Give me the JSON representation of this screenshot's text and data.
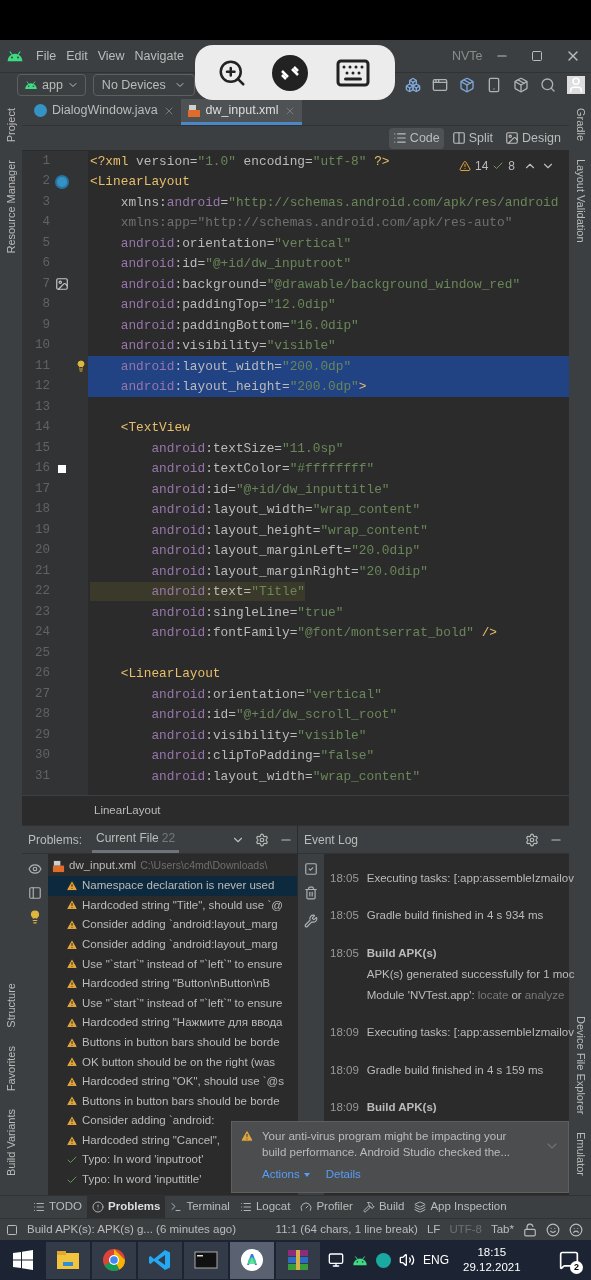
{
  "menu": [
    "File",
    "Edit",
    "View",
    "Navigate"
  ],
  "window": {
    "title": "NVTe"
  },
  "toolbar": {
    "module": "app",
    "device": "No Devices"
  },
  "editor_tabs": [
    {
      "label": "DialogWindow.java",
      "kind": "java",
      "selected": false
    },
    {
      "label": "dw_input.xml",
      "kind": "xml",
      "selected": true
    }
  ],
  "view_modes": [
    {
      "label": "Code",
      "kind": "code",
      "selected": true
    },
    {
      "label": "Split",
      "kind": "split",
      "selected": false
    },
    {
      "label": "Design",
      "kind": "design",
      "selected": false
    }
  ],
  "left_strip": [
    {
      "label": "Project",
      "kind": "top"
    },
    {
      "label": "Resource Manager",
      "kind": "top"
    },
    {
      "label": "Structure",
      "kind": "bottom"
    },
    {
      "label": "Favorites",
      "kind": "bottom"
    },
    {
      "label": "Build Variants",
      "kind": "bottom"
    }
  ],
  "right_strip": [
    {
      "label": "Gradle",
      "kind": "top"
    },
    {
      "label": "Layout Validation",
      "kind": "top"
    },
    {
      "label": "Device File Explorer",
      "kind": "bottom"
    },
    {
      "label": "Emulator",
      "kind": "bottom"
    }
  ],
  "inspections": {
    "warnings": "14",
    "typos": "8"
  },
  "code_lines": [
    {
      "number": "1",
      "kind": "plain",
      "selected": false,
      "tokens": [
        {
          "kind": "tag",
          "text": "<?xml "
        },
        {
          "kind": "attr",
          "text": "version="
        },
        {
          "kind": "value",
          "text": "\"1.0\" "
        },
        {
          "kind": "attr",
          "text": "encoding="
        },
        {
          "kind": "value",
          "text": "\"utf-8\" "
        },
        {
          "kind": "tag",
          "text": "?>"
        }
      ]
    },
    {
      "number": "2",
      "kind": "class",
      "selected": false,
      "tokens": [
        {
          "kind": "tag",
          "text": "<LinearLayout"
        }
      ]
    },
    {
      "number": "3",
      "kind": "plain",
      "selected": false,
      "tokens": [
        {
          "kind": "attr",
          "text": "    xmlns:"
        },
        {
          "kind": "ns",
          "text": "android"
        },
        {
          "kind": "attr",
          "text": "="
        },
        {
          "kind": "value",
          "text": "\"http://schemas.android.com/apk/res/android"
        }
      ]
    },
    {
      "number": "4",
      "kind": "plain",
      "selected": false,
      "tokens": [
        {
          "kind": "unused",
          "text": "    xmlns:app=\"http://schemas.android.com/apk/res-auto\""
        }
      ]
    },
    {
      "number": "5",
      "kind": "plain",
      "selected": false,
      "tokens": [
        {
          "kind": "ns",
          "text": "    android"
        },
        {
          "kind": "attr",
          "text": ":orientation="
        },
        {
          "kind": "value",
          "text": "\"vertical\""
        }
      ]
    },
    {
      "number": "6",
      "kind": "plain",
      "selected": false,
      "tokens": [
        {
          "kind": "ns",
          "text": "    android"
        },
        {
          "kind": "attr",
          "text": ":id="
        },
        {
          "kind": "value",
          "text": "\"@+id/dw_inputroot\""
        }
      ]
    },
    {
      "number": "7",
      "kind": "image",
      "selected": false,
      "tokens": [
        {
          "kind": "ns",
          "text": "    android"
        },
        {
          "kind": "attr",
          "text": ":background="
        },
        {
          "kind": "value",
          "text": "\"@drawable/background_window_red\""
        }
      ]
    },
    {
      "number": "8",
      "kind": "plain",
      "selected": false,
      "tokens": [
        {
          "kind": "ns",
          "text": "    android"
        },
        {
          "kind": "attr",
          "text": ":paddingTop="
        },
        {
          "kind": "value",
          "text": "\"12.0dip\""
        }
      ]
    },
    {
      "number": "9",
      "kind": "plain",
      "selected": false,
      "tokens": [
        {
          "kind": "ns",
          "text": "    android"
        },
        {
          "kind": "attr",
          "text": ":paddingBottom="
        },
        {
          "kind": "value",
          "text": "\"16.0dip\""
        }
      ]
    },
    {
      "number": "10",
      "kind": "plain",
      "selected": false,
      "tokens": [
        {
          "kind": "ns",
          "text": "    android"
        },
        {
          "kind": "attr",
          "text": ":visibility="
        },
        {
          "kind": "value",
          "text": "\"visible\""
        }
      ]
    },
    {
      "number": "11",
      "kind": "bulb",
      "selected": true,
      "tokens": [
        {
          "kind": "ns",
          "text": "    android"
        },
        {
          "kind": "attr",
          "text": ":layout_width="
        },
        {
          "kind": "value",
          "text": "\"200.0dp\""
        }
      ]
    },
    {
      "number": "12",
      "kind": "plain",
      "selected": true,
      "tokens": [
        {
          "kind": "ns",
          "text": "    android"
        },
        {
          "kind": "attr",
          "text": ":layout_height="
        },
        {
          "kind": "value",
          "text": "\"200.0dp\""
        },
        {
          "kind": "tag",
          "text": ">"
        }
      ]
    },
    {
      "number": "13",
      "kind": "plain",
      "selected": false
    },
    {
      "number": "14",
      "kind": "plain",
      "selected": false,
      "tokens": [
        {
          "kind": "tag",
          "text": "    <TextView"
        }
      ]
    },
    {
      "number": "15",
      "kind": "plain",
      "selected": false,
      "tokens": [
        {
          "kind": "ns",
          "text": "        android"
        },
        {
          "kind": "attr",
          "text": ":textSize="
        },
        {
          "kind": "value",
          "text": "\"11.0sp\""
        }
      ]
    },
    {
      "number": "16",
      "kind": "color",
      "selected": false,
      "tokens": [
        {
          "kind": "ns",
          "text": "        android"
        },
        {
          "kind": "attr",
          "text": ":textColor="
        },
        {
          "kind": "value",
          "text": "\"#ffffffff\""
        }
      ]
    },
    {
      "number": "17",
      "kind": "plain",
      "selected": false,
      "tokens": [
        {
          "kind": "ns",
          "text": "        android"
        },
        {
          "kind": "attr",
          "text": ":id="
        },
        {
          "kind": "value",
          "text": "\"@+id/dw_inputtitle\""
        }
      ]
    },
    {
      "number": "18",
      "kind": "plain",
      "selected": false,
      "tokens": [
        {
          "kind": "ns",
          "text": "        android"
        },
        {
          "kind": "attr",
          "text": ":layout_width="
        },
        {
          "kind": "value",
          "text": "\"wrap_content\""
        }
      ]
    },
    {
      "number": "19",
      "kind": "plain",
      "selected": false,
      "tokens": [
        {
          "kind": "ns",
          "text": "        android"
        },
        {
          "kind": "attr",
          "text": ":layout_height="
        },
        {
          "kind": "value",
          "text": "\"wrap_content\""
        }
      ]
    },
    {
      "number": "20",
      "kind": "plain",
      "selected": false,
      "tokens": [
        {
          "kind": "ns",
          "text": "        android"
        },
        {
          "kind": "attr",
          "text": ":layout_marginLeft="
        },
        {
          "kind": "value",
          "text": "\"20.0dip\""
        }
      ]
    },
    {
      "number": "21",
      "kind": "plain",
      "selected": false,
      "tokens": [
        {
          "kind": "ns",
          "text": "        android"
        },
        {
          "kind": "attr",
          "text": ":layout_marginRight="
        },
        {
          "kind": "value",
          "text": "\"20.0dip\""
        }
      ]
    },
    {
      "number": "22",
      "kind": "marked",
      "selected": false,
      "tokens": [
        {
          "kind": "ns",
          "text": "        android"
        },
        {
          "kind": "attr",
          "text": ":text="
        },
        {
          "kind": "value",
          "text": "\"Title\""
        }
      ]
    },
    {
      "number": "23",
      "kind": "plain",
      "selected": false,
      "tokens": [
        {
          "kind": "ns",
          "text": "        android"
        },
        {
          "kind": "attr",
          "text": ":singleLine="
        },
        {
          "kind": "value",
          "text": "\"true\""
        }
      ]
    },
    {
      "number": "24",
      "kind": "plain",
      "selected": false,
      "tokens": [
        {
          "kind": "ns",
          "text": "        android"
        },
        {
          "kind": "attr",
          "text": ":fontFamily="
        },
        {
          "kind": "value",
          "text": "\"@font/montserrat_bold\" "
        },
        {
          "kind": "tag",
          "text": "/>"
        }
      ]
    },
    {
      "number": "25",
      "kind": "plain",
      "selected": false
    },
    {
      "number": "26",
      "kind": "plain",
      "selected": false,
      "tokens": [
        {
          "kind": "tag",
          "text": "    <LinearLayout"
        }
      ]
    },
    {
      "number": "27",
      "kind": "plain",
      "selected": false,
      "tokens": [
        {
          "kind": "ns",
          "text": "        android"
        },
        {
          "kind": "attr",
          "text": ":orientation="
        },
        {
          "kind": "value",
          "text": "\"vertical\""
        }
      ]
    },
    {
      "number": "28",
      "kind": "plain",
      "selected": false,
      "tokens": [
        {
          "kind": "ns",
          "text": "        android"
        },
        {
          "kind": "attr",
          "text": ":id="
        },
        {
          "kind": "value",
          "text": "\"@+id/dw_scroll_root\""
        }
      ]
    },
    {
      "number": "29",
      "kind": "plain",
      "selected": false,
      "tokens": [
        {
          "kind": "ns",
          "text": "        android"
        },
        {
          "kind": "attr",
          "text": ":visibility="
        },
        {
          "kind": "value",
          "text": "\"visible\""
        }
      ]
    },
    {
      "number": "30",
      "kind": "plain",
      "selected": false,
      "tokens": [
        {
          "kind": "ns",
          "text": "        android"
        },
        {
          "kind": "attr",
          "text": ":clipToPadding="
        },
        {
          "kind": "value",
          "text": "\"false\""
        }
      ]
    },
    {
      "number": "31",
      "kind": "plain",
      "selected": false,
      "tokens": [
        {
          "kind": "ns",
          "text": "        android"
        },
        {
          "kind": "attr",
          "text": ":layout_width="
        },
        {
          "kind": "value",
          "text": "\"wrap_content\""
        }
      ]
    }
  ],
  "breadcrumb": "LinearLayout",
  "problems": {
    "title": "Problems:",
    "tab": "Current File",
    "count": "22",
    "file": {
      "name": "dw_input.xml",
      "path": "C:\\Users\\c4md\\Downloads\\"
    },
    "items": [
      {
        "kind": "warning",
        "selected": true,
        "text": "Namespace declaration is never used"
      },
      {
        "kind": "warning",
        "selected": false,
        "text": "Hardcoded string \"Title\", should use `@"
      },
      {
        "kind": "warning",
        "selected": false,
        "text": "Consider adding `android:layout_marg"
      },
      {
        "kind": "warning",
        "selected": false,
        "text": "Consider adding `android:layout_marg"
      },
      {
        "kind": "warning",
        "selected": false,
        "text": "Use \"`start`\" instead of \"`left`\" to ensure"
      },
      {
        "kind": "warning",
        "selected": false,
        "text": "Hardcoded string \"Button\\nButton\\nB"
      },
      {
        "kind": "warning",
        "selected": false,
        "text": "Use \"`start`\" instead of \"`left`\" to ensure"
      },
      {
        "kind": "warning",
        "selected": false,
        "text": "Hardcoded string \"Нажмите для ввода"
      },
      {
        "kind": "warning",
        "selected": false,
        "text": "Buttons in button bars should be borde"
      },
      {
        "kind": "warning",
        "selected": false,
        "text": "OK button should be on the right (was"
      },
      {
        "kind": "warning",
        "selected": false,
        "text": "Hardcoded string \"OK\", should use `@s"
      },
      {
        "kind": "warning",
        "selected": false,
        "text": "Buttons in button bars should be borde"
      },
      {
        "kind": "warning",
        "selected": false,
        "text": "Consider adding `android:"
      },
      {
        "kind": "warning",
        "selected": false,
        "text": "Hardcoded string \"Cancel\","
      },
      {
        "kind": "typo",
        "selected": false,
        "text": "Typo: In word 'inputroot'"
      },
      {
        "kind": "typo",
        "selected": false,
        "text": "Typo: In word 'inputtitle'"
      }
    ]
  },
  "event_log": {
    "title": "Event Log",
    "entries": [
      {
        "time": "18:05",
        "bold": false,
        "title": "Executing tasks: [:app:assembleIzmailov"
      },
      {
        "time": "18:05",
        "bold": false,
        "title": "Gradle build finished in 4 s 934 ms"
      },
      {
        "time": "18:05",
        "bold": true,
        "title": "Build APK(s)",
        "lines": [
          [
            {
              "text": "APK(s) generated successfully for 1 moc",
              "link": false
            }
          ],
          [
            {
              "text": "Module 'NVTest.app':",
              "link": false
            },
            {
              "text": "locate",
              "link": true
            },
            {
              "text": "or",
              "link": false
            },
            {
              "text": "analyze",
              "link": true
            }
          ]
        ]
      },
      {
        "time": "18:09",
        "bold": false,
        "title": "Executing tasks: [:app:assembleIzmailov"
      },
      {
        "time": "18:09",
        "bold": false,
        "title": "Gradle build finished in 4 s 159 ms"
      },
      {
        "time": "18:09",
        "bold": true,
        "title": "Build APK(s)"
      }
    ]
  },
  "notification": {
    "text": "Your anti-virus program might be impacting your build performance. Android Studio checked the...",
    "actions": [
      "Actions",
      "Details"
    ]
  },
  "tool_tabs": [
    {
      "label": "TODO",
      "kind": "todo",
      "selected": false
    },
    {
      "label": "Problems",
      "kind": "problems",
      "selected": true
    },
    {
      "label": "Terminal",
      "kind": "terminal",
      "selected": false
    },
    {
      "label": "Logcat",
      "kind": "logcat",
      "selected": false
    },
    {
      "label": "Profiler",
      "kind": "profiler",
      "selected": false
    },
    {
      "label": "Build",
      "kind": "build",
      "selected": false
    },
    {
      "label": "App Inspection",
      "kind": "inspection",
      "selected": false
    }
  ],
  "status_bar": {
    "message": "Build APK(s): APK(s) g... (6 minutes ago)",
    "position": "11:1 (64 chars, 1 line break)",
    "line_ending": "LF",
    "encoding": "UTF-8",
    "indent": "Tab*"
  },
  "taskbar": {
    "apps": [
      {
        "kind": "explorer",
        "selected": false
      },
      {
        "kind": "chrome",
        "selected": false
      },
      {
        "kind": "vscode",
        "selected": false
      },
      {
        "kind": "console",
        "selected": false
      },
      {
        "kind": "studio",
        "selected": true
      },
      {
        "kind": "archiver",
        "selected": false
      }
    ],
    "language": "ENG",
    "time": "18:15",
    "date": "29.12.2021",
    "notifications": "2"
  }
}
